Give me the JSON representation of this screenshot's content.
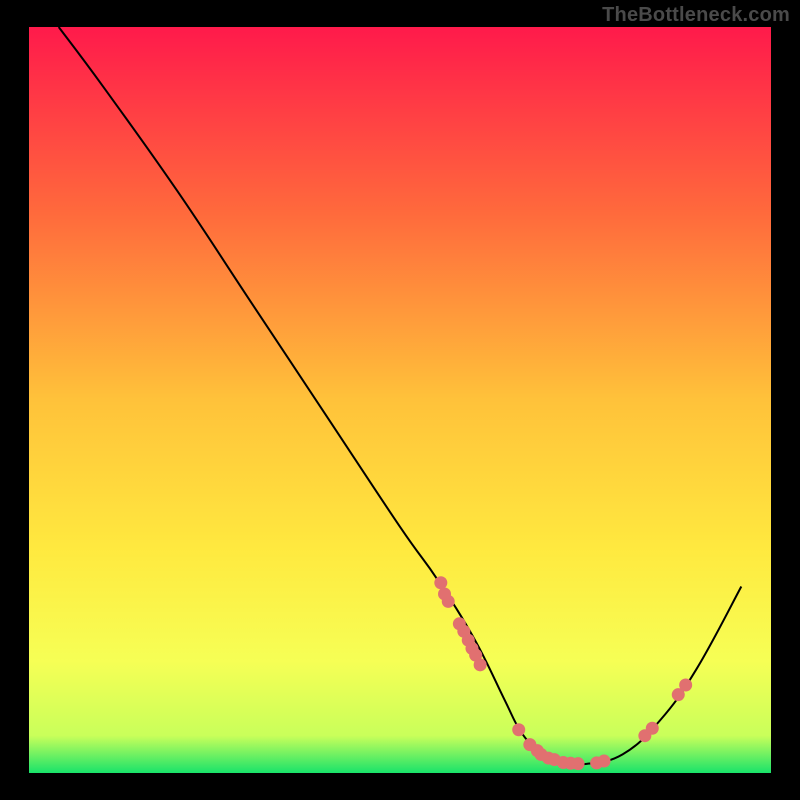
{
  "watermark": "TheBottleneck.com",
  "chart_data": {
    "type": "line",
    "title": "",
    "xlabel": "",
    "ylabel": "",
    "xlim": [
      0,
      100
    ],
    "ylim": [
      0,
      100
    ],
    "gradient_stops": [
      {
        "offset": 0,
        "color": "#ff1a4b"
      },
      {
        "offset": 25,
        "color": "#ff6a3c"
      },
      {
        "offset": 50,
        "color": "#ffc23a"
      },
      {
        "offset": 70,
        "color": "#ffe93f"
      },
      {
        "offset": 85,
        "color": "#f6ff55"
      },
      {
        "offset": 95,
        "color": "#c9ff5a"
      },
      {
        "offset": 100,
        "color": "#19e36a"
      }
    ],
    "series": [
      {
        "name": "bottleneck-curve",
        "x": [
          4,
          10,
          20,
          30,
          40,
          50,
          55,
          60,
          64,
          66,
          68,
          70,
          72,
          75,
          80,
          85,
          90,
          96
        ],
        "y": [
          100,
          92,
          78,
          63,
          48,
          33,
          26,
          18,
          10,
          6,
          3.5,
          2,
          1.4,
          1.2,
          2.5,
          7,
          14,
          25
        ]
      }
    ],
    "scatter": {
      "name": "highlight-dots",
      "color": "#e17070",
      "points": [
        {
          "x": 55.5,
          "y": 25.5
        },
        {
          "x": 56.0,
          "y": 24.0
        },
        {
          "x": 56.5,
          "y": 23.0
        },
        {
          "x": 58.0,
          "y": 20.0
        },
        {
          "x": 58.6,
          "y": 19.0
        },
        {
          "x": 59.2,
          "y": 17.8
        },
        {
          "x": 59.7,
          "y": 16.7
        },
        {
          "x": 60.2,
          "y": 15.8
        },
        {
          "x": 60.8,
          "y": 14.5
        },
        {
          "x": 66.0,
          "y": 5.8
        },
        {
          "x": 67.5,
          "y": 3.8
        },
        {
          "x": 68.5,
          "y": 3.0
        },
        {
          "x": 69.0,
          "y": 2.5
        },
        {
          "x": 70.0,
          "y": 2.0
        },
        {
          "x": 70.8,
          "y": 1.8
        },
        {
          "x": 72.0,
          "y": 1.4
        },
        {
          "x": 73.0,
          "y": 1.3
        },
        {
          "x": 74.0,
          "y": 1.25
        },
        {
          "x": 76.5,
          "y": 1.35
        },
        {
          "x": 77.5,
          "y": 1.6
        },
        {
          "x": 83.0,
          "y": 5.0
        },
        {
          "x": 84.0,
          "y": 6.0
        },
        {
          "x": 87.5,
          "y": 10.5
        },
        {
          "x": 88.5,
          "y": 11.8
        }
      ]
    }
  }
}
